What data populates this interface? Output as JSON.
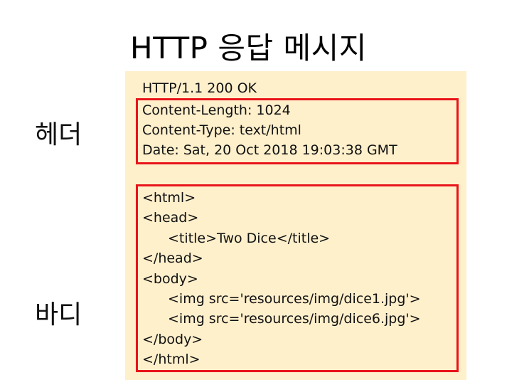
{
  "title": "HTTP 응답 메시지",
  "labels": {
    "header": "헤더",
    "body": "바디"
  },
  "status_line": "HTTP/1.1 200 OK",
  "header_lines": [
    "Content-Length: 1024",
    "Content-Type: text/html",
    "Date: Sat, 20 Oct 2018 19:03:38 GMT"
  ],
  "body_lines": [
    "<html>",
    "<head>",
    "<title>Two Dice</title>",
    "</head>",
    "<body>",
    "<img src='resources/img/dice1.jpg'>",
    "<img src='resources/img/dice6.jpg'>",
    "</body>",
    "</html>"
  ],
  "colors": {
    "panel_background": "#fff0cc",
    "highlight_border": "#e8141a"
  }
}
